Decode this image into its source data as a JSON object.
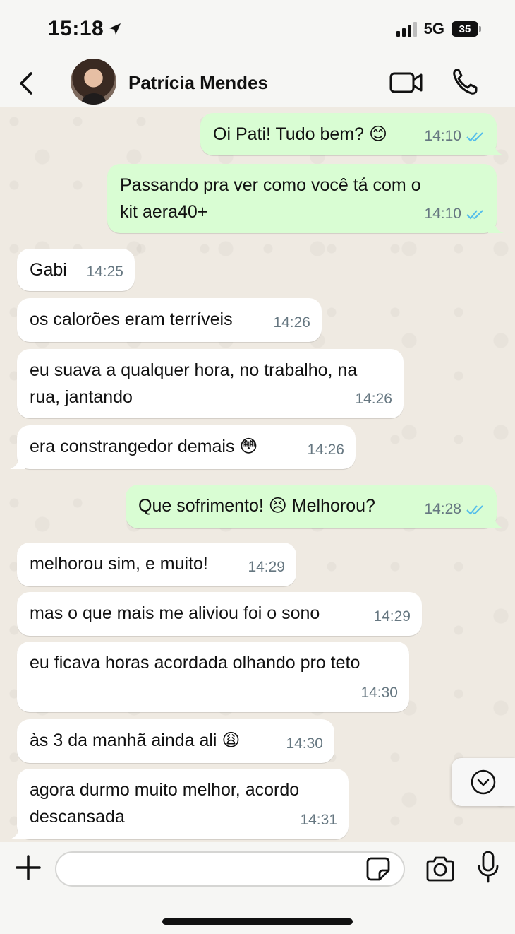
{
  "status_bar": {
    "time": "15:18",
    "network": "5G",
    "battery": "35"
  },
  "header": {
    "contact_name": "Patrícia Mendes",
    "avatar_icon": "contact-photo",
    "icons": [
      "chevron-left-icon",
      "video-camera-icon",
      "phone-icon"
    ]
  },
  "messages": [
    {
      "dir": "out",
      "text": "Oi Pati! Tudo bem? 😊",
      "time": "14:10",
      "read": true
    },
    {
      "dir": "out",
      "text": "Passando pra ver como você tá com o kit aera40+",
      "time": "14:10",
      "read": true
    },
    {
      "dir": "in",
      "text": "Gabi",
      "time": "14:25"
    },
    {
      "dir": "in",
      "text": "os calorões eram terríveis",
      "time": "14:26"
    },
    {
      "dir": "in",
      "text": "eu suava a qualquer hora, no trabalho, na rua, jantando",
      "time": "14:26"
    },
    {
      "dir": "in",
      "text": "era constrangedor demais 😳",
      "time": "14:26"
    },
    {
      "dir": "out",
      "text": "Que sofrimento! 😣  Melhorou?",
      "time": "14:28",
      "read": true
    },
    {
      "dir": "in",
      "text": "melhorou sim, e muito!",
      "time": "14:29"
    },
    {
      "dir": "in",
      "text": "mas o que mais me aliviou foi o sono",
      "time": "14:29"
    },
    {
      "dir": "in",
      "text": "eu ficava horas acordada olhando pro teto",
      "time": "14:30"
    },
    {
      "dir": "in",
      "text": "às 3 da manhã ainda ali 😩",
      "time": "14:30"
    },
    {
      "dir": "in",
      "text": "agora durmo muito melhor, acordo descansada",
      "time": "14:31"
    }
  ],
  "input": {
    "value": "",
    "placeholder": ""
  },
  "colors": {
    "outgoing_bubble": "#d9fdd3",
    "incoming_bubble": "#ffffff",
    "read_ticks": "#53bdeb",
    "chat_background": "#efeae2"
  }
}
